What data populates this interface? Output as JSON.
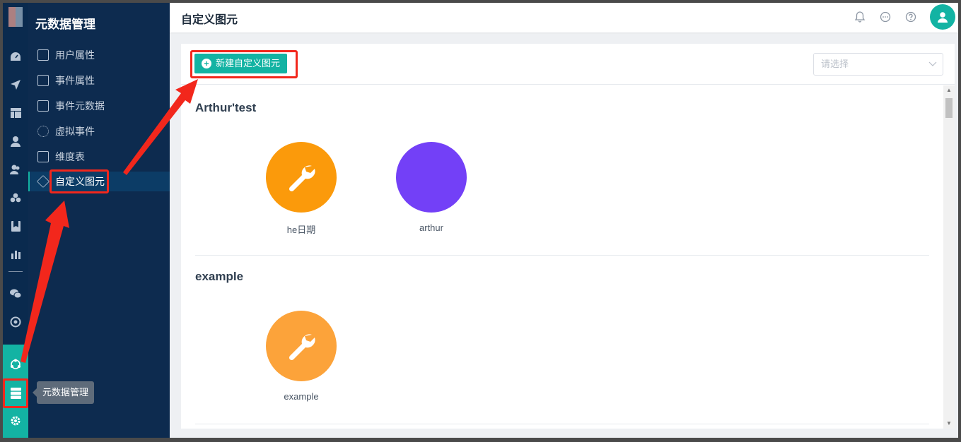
{
  "sidebar": {
    "title": "元数据管理",
    "items": [
      {
        "label": "用户属性",
        "icon": "profile-icon"
      },
      {
        "label": "事件属性",
        "icon": "clipboard-icon"
      },
      {
        "label": "事件元数据",
        "icon": "database-icon"
      },
      {
        "label": "虚拟事件",
        "icon": "dashed-circle-icon"
      },
      {
        "label": "维度表",
        "icon": "table-icon"
      },
      {
        "label": "自定义图元",
        "icon": "cube-icon",
        "active": true
      }
    ]
  },
  "rail": {
    "icons": [
      "dashboard-icon",
      "send-icon",
      "layout-icon",
      "user-icon",
      "users-icon",
      "cluster-icon",
      "bookmark-icon",
      "bar-chart-icon",
      "wechat-icon",
      "target-icon",
      "network-icon",
      "server-icon",
      "gear-icon"
    ],
    "tooltip": "元数据管理"
  },
  "header": {
    "title": "自定义图元",
    "icons": [
      "bell-icon",
      "chat-icon",
      "help-icon",
      "avatar-icon"
    ]
  },
  "toolbar": {
    "new_button": "新建自定义图元",
    "select_placeholder": "请选择"
  },
  "groups": [
    {
      "title": "Arthur'test",
      "items": [
        {
          "label": "he日期",
          "color": "#fb9a0b",
          "icon": "wrench-icon"
        },
        {
          "label": "arthur",
          "color": "#7340f7",
          "icon": ""
        }
      ]
    },
    {
      "title": "example",
      "items": [
        {
          "label": "example",
          "color": "#fca33a",
          "icon": "wrench-icon"
        }
      ]
    }
  ],
  "colors": {
    "accent": "#13b3a3",
    "sidebar": "#0d2b4f",
    "annotation": "#f2271c"
  }
}
